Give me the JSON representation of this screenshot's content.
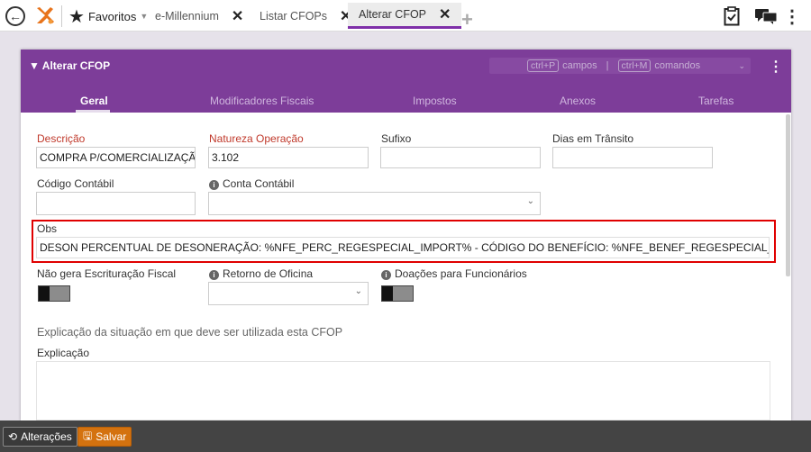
{
  "topbar": {
    "favorites_label": "Favoritos",
    "tabs": [
      {
        "label": "e-Millennium",
        "close": "✕"
      },
      {
        "label": "Listar CFOPs",
        "close": "✕"
      },
      {
        "label": "Alterar CFOP",
        "close": "✕"
      }
    ],
    "active_tab_index": 2,
    "add_tab": "+"
  },
  "card": {
    "title": "Alterar CFOP",
    "hint_fields_key": "ctrl+P",
    "hint_fields_label": "campos",
    "hint_separator": "|",
    "hint_commands_key": "ctrl+M",
    "hint_commands_label": "comandos",
    "tabs": [
      "Geral",
      "Modificadores Fiscais",
      "Impostos",
      "Anexos",
      "Tarefas"
    ],
    "active_tab": "Geral"
  },
  "form": {
    "descricao_label": "Descrição",
    "descricao_value": "COMPRA P/COMERCIALIZAÇÃO R",
    "natureza_label": "Natureza Operação",
    "natureza_value": "3.102",
    "sufixo_label": "Sufixo",
    "sufixo_value": "",
    "dias_label": "Dias em Trânsito",
    "dias_value": "",
    "codigo_contabil_label": "Código Contábil",
    "codigo_contabil_value": "",
    "conta_contabil_label": "Conta Contábil",
    "conta_contabil_value": "",
    "obs_label": "Obs",
    "obs_value": "DESON PERCENTUAL DE DESONERAÇÃO: %NFE_PERC_REGESPECIAL_IMPORT% - CÓDIGO DO BENEFÍCIO: %NFE_BENEF_REGESPECIAL_IMPORT%",
    "nao_gera_label": "Não gera Escrituração Fiscal",
    "nao_gera_on": false,
    "retorno_label": "Retorno de Oficina",
    "retorno_value": "",
    "doacoes_label": "Doações para Funcionários",
    "doacoes_on": false,
    "section_title": "Explicação da situação em que deve ser utilizada esta CFOP",
    "explicacao_label": "Explicação",
    "explicacao_value": ""
  },
  "footer": {
    "alteracoes_label": "Alterações",
    "salvar_label": "Salvar"
  },
  "colors": {
    "brand_purple": "#7d3d99",
    "tab_active_underline": "#7e2fa8",
    "save_orange": "#d4720f",
    "highlight_red": "#e00000",
    "required_red": "#c0392b"
  }
}
